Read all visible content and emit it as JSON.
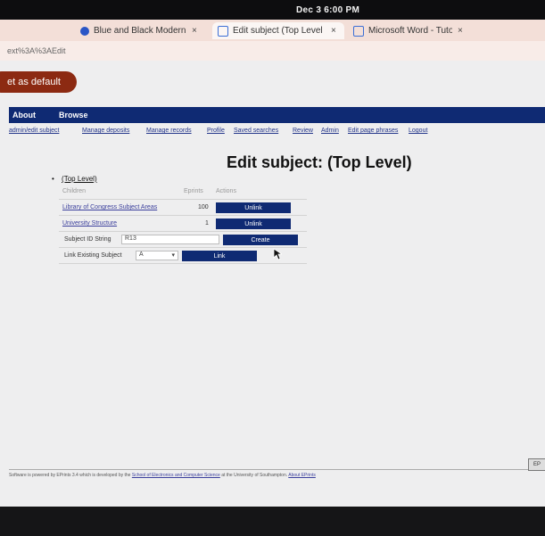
{
  "system": {
    "clock": "Dec 3   6:00 PM"
  },
  "tabs": [
    {
      "label": "Blue and Black Modern",
      "active": false,
      "icon": "canva-icon",
      "color": "#2a56c6"
    },
    {
      "label": "Edit subject (Top Level",
      "active": true,
      "icon": "document-icon",
      "color": "#3b6fd6"
    },
    {
      "label": "Microsoft Word - Tuto",
      "active": false,
      "icon": "document-icon",
      "color": "#3b6fd6"
    }
  ],
  "url": "ext%3A%3AEdit",
  "default_button": "et as default",
  "nav": {
    "items": [
      "About",
      "Browse"
    ],
    "color": "#0f2a73"
  },
  "subnav": [
    "admin/edit subject",
    "Manage deposits",
    "Manage records",
    "Profile",
    "Saved searches",
    "Review",
    "Admin",
    "Edit page phrases",
    "Logout"
  ],
  "page_title": "Edit subject: (Top Level)",
  "tree": {
    "bullet": "•",
    "root": "(Top Level)"
  },
  "table": {
    "headers": {
      "children": "Children",
      "eprints": "Eprints",
      "actions": "Actions"
    },
    "rows": [
      {
        "name": "Library of Congress Subject Areas",
        "count": "100",
        "action": "Unlink"
      },
      {
        "name": "University Structure",
        "count": "1",
        "action": "Unlink"
      }
    ],
    "subject_id": {
      "label": "Subject ID String",
      "value": "R13",
      "action": "Create"
    },
    "link_existing": {
      "label": "Link Existing Subject",
      "selected": "A",
      "action": "Link"
    }
  },
  "footer": {
    "text": "Software is powered by EPrints 3.4 which is developed by the",
    "link1": "School of Electronics and Computer Science",
    "text2": "at the University of Southampton.",
    "link2": "About EPrints",
    "badge": "EP"
  }
}
